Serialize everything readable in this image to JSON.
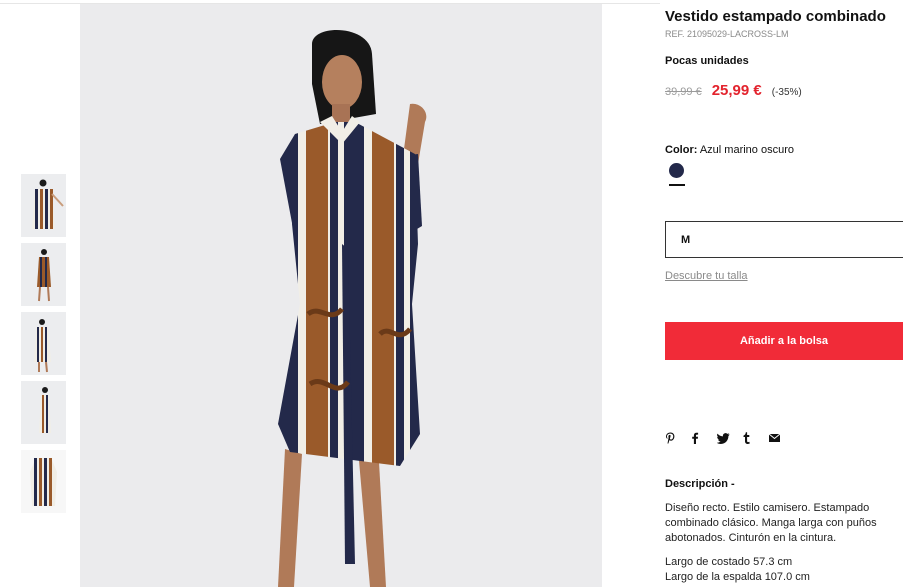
{
  "product": {
    "title": "Vestido estampado combinado",
    "ref": "REF. 21095029-LACROSS-LM",
    "stock": "Pocas unidades",
    "old_price": "39,99 €",
    "new_price": "25,99 €",
    "discount": "(-35%)",
    "color_label": "Color:",
    "color_value": "Azul marino oscuro",
    "swatch_color": "#23294a",
    "size_value": "M",
    "size_guide": "Descubre tu talla",
    "add_to_bag": "Añadir a la bolsa",
    "share_icons": [
      "pinterest-icon",
      "facebook-icon",
      "twitter-icon",
      "tumblr-icon",
      "email-icon"
    ],
    "description_title": "Descripción -",
    "description": "Diseño recto. Estilo camisero. Estampado combinado clásico. Manga larga con puños abotonados. Cinturón en la cintura.",
    "measure_1": "Largo de costado 57.3 cm",
    "measure_2": "Largo de la espalda 107.0 cm"
  },
  "colors": {
    "accent_red": "#f12b38",
    "price_red": "#e3232d",
    "navy": "#23294a",
    "brown": "#9a5a2a",
    "cream": "#f1eee6"
  }
}
